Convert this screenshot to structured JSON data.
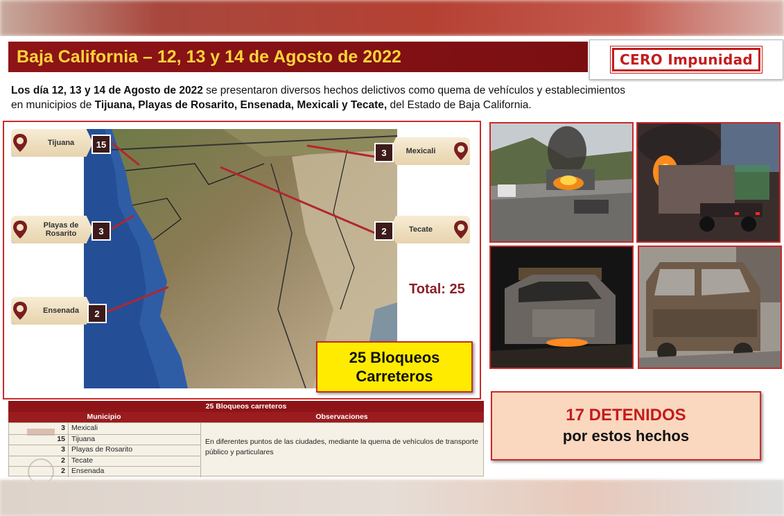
{
  "slide": {
    "title": "Baja California – 12, 13 y 14 de Agosto de 2022",
    "logo_text": "CERO Impunidad",
    "description": {
      "line1_bold": "Los día 12, 13 y 14 de Agosto de 2022",
      "line1_rest": " se presentaron diversos hechos delictivos como quema de vehículos y establecimientos",
      "line2_start": "en municipios de ",
      "line2_bold": "Tijuana, Playas de Rosarito, Ensenada, Mexicali y Tecate,",
      "line2_rest": " del Estado de Baja California."
    }
  },
  "map": {
    "pins": [
      {
        "label": "Tijuana",
        "count": "15"
      },
      {
        "label": "Playas de Rosarito",
        "count": "3"
      },
      {
        "label": "Ensenada",
        "count": "2"
      },
      {
        "label": "Mexicali",
        "count": "3"
      },
      {
        "label": "Tecate",
        "count": "2"
      }
    ],
    "total": "Total: 25",
    "callout_line1": "25 Bloqueos",
    "callout_line2": "Carreteros"
  },
  "table": {
    "caption": "25 Bloqueos carreteros",
    "col_municipio": "Municipio",
    "col_observaciones": "Observaciones",
    "rows": [
      {
        "n": "3",
        "m": "Mexicali"
      },
      {
        "n": "15",
        "m": "Tijuana"
      },
      {
        "n": "3",
        "m": "Playas de Rosarito"
      },
      {
        "n": "2",
        "m": "Tecate"
      },
      {
        "n": "2",
        "m": "Ensenada"
      }
    ],
    "observaciones": "En diferentes puntos de las ciudades, mediante la quema de vehículos de transporte público y particulares"
  },
  "detenidos": {
    "line1": "17 DETENIDOS",
    "line2": "por estos hechos"
  },
  "colors": {
    "title_bg": "#8e1417",
    "title_text": "#ffd43a",
    "accent_red": "#c92a2a",
    "callout_yellow": "#ffeb00",
    "callout_orange": "#fad7bf"
  }
}
